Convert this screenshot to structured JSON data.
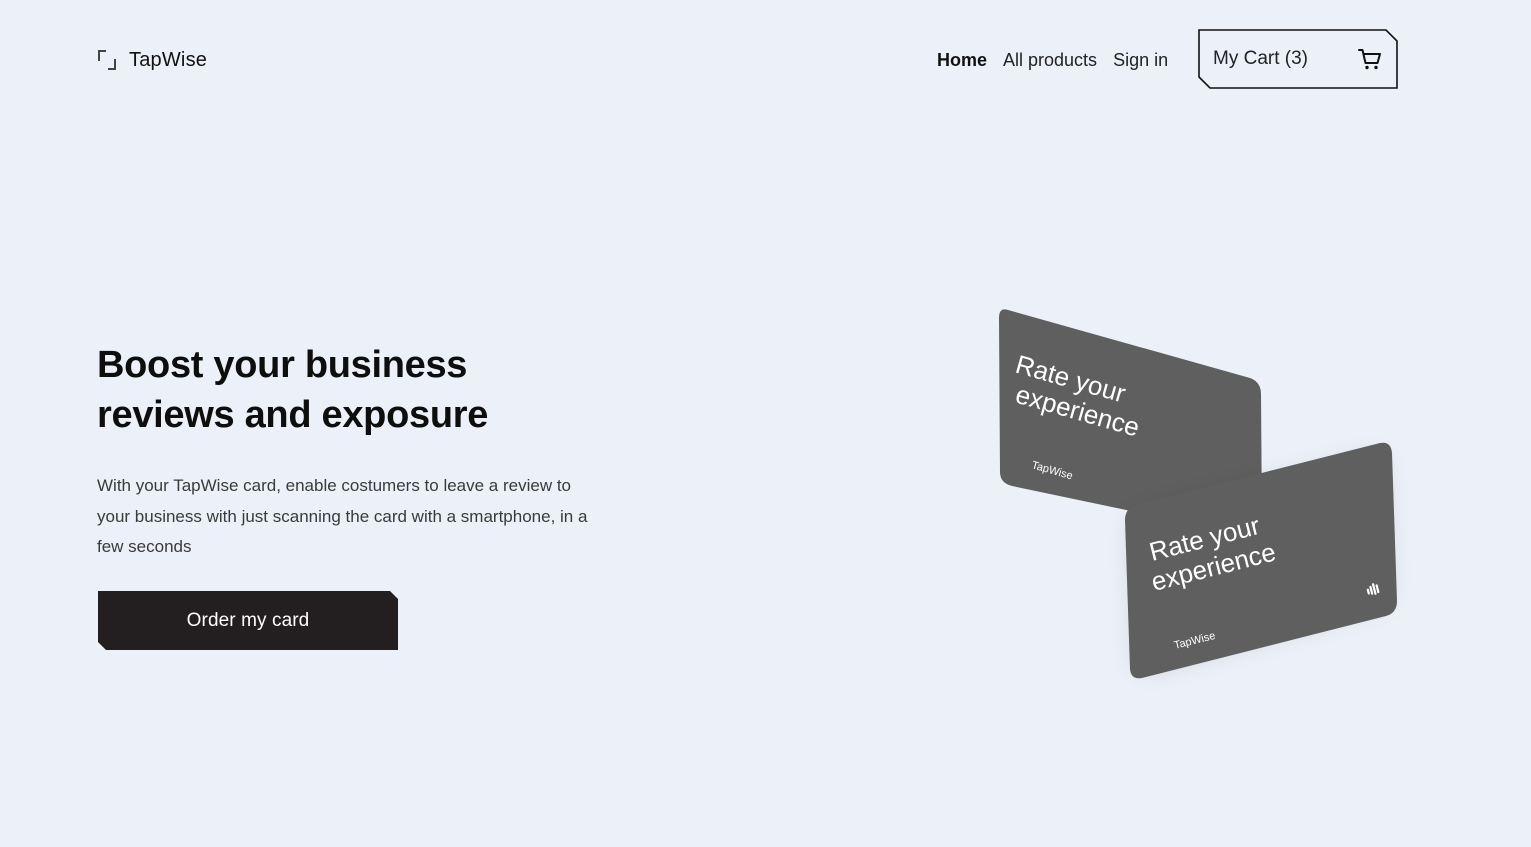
{
  "brand": {
    "name": "TapWise",
    "logo_icon": "bracket-corners-icon"
  },
  "nav": {
    "links": [
      {
        "label": "Home",
        "active": true
      },
      {
        "label": "All products",
        "active": false
      },
      {
        "label": "Sign in",
        "active": false
      }
    ],
    "cart": {
      "label": "My Cart (3)",
      "icon": "shopping-cart-icon"
    }
  },
  "hero": {
    "title_line1": "Boost your business",
    "title_line2": "reviews and exposure",
    "description": "With your TapWise card, enable costumers to leave a review to your business with just scanning the card with a smartphone, in a few seconds",
    "cta_label": "Order my card"
  },
  "cards": {
    "back_card": {
      "text_line1": "Rate your",
      "text_line2": "experience",
      "brand": "TapWise"
    },
    "front_card": {
      "text_line1": "Rate your",
      "text_line2": "experience",
      "brand": "TapWise",
      "icon": "nfc-icon"
    }
  },
  "colors": {
    "background": "#ecf0f8",
    "card": "#5f5f5f",
    "button": "#231f21",
    "text": "#111111"
  }
}
